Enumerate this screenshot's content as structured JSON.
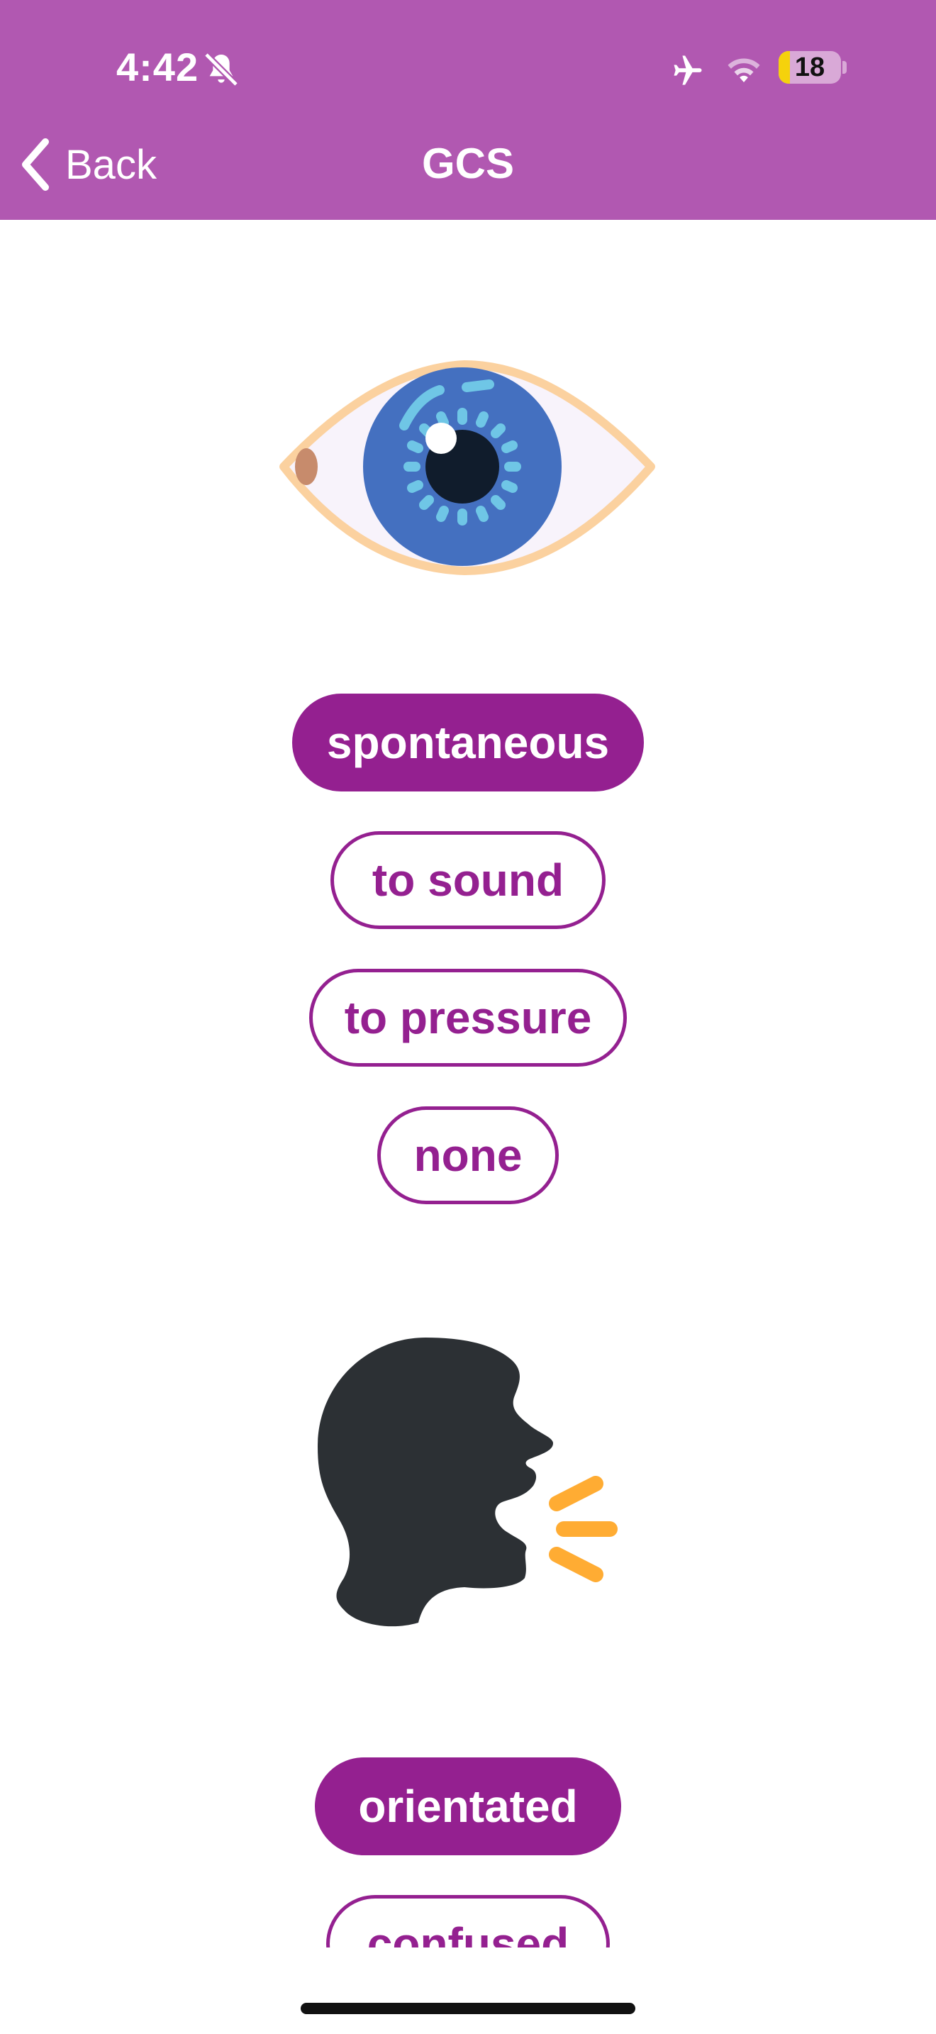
{
  "status_bar": {
    "time": "4:42",
    "battery": "18",
    "battery_level": 0.18,
    "icons": [
      "bell-slash-icon",
      "airplane-icon",
      "wifi-icon",
      "battery-icon"
    ]
  },
  "nav": {
    "back_label": "Back",
    "title": "GCS"
  },
  "eye_section": {
    "icon": "eye-icon",
    "options": [
      {
        "label": "spontaneous",
        "selected": true
      },
      {
        "label": "to sound",
        "selected": false
      },
      {
        "label": "to pressure",
        "selected": false
      },
      {
        "label": "none",
        "selected": false
      }
    ]
  },
  "verbal_section": {
    "icon": "speaking-head-icon",
    "options": [
      {
        "label": "orientated",
        "selected": true
      },
      {
        "label": "confused",
        "selected": false
      }
    ]
  },
  "colors": {
    "header": "#b158b1",
    "accent": "#942090",
    "eye_iris": "#4470c0",
    "speech_lines": "#ffac33",
    "head": "#2c3034"
  }
}
